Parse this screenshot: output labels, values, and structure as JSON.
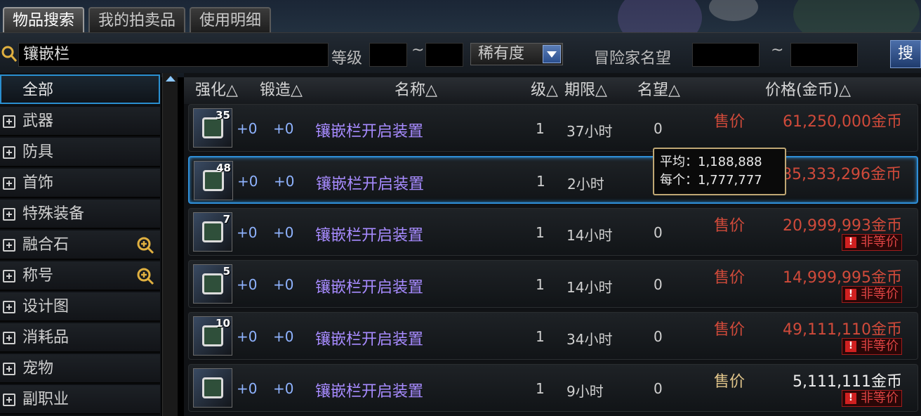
{
  "tabs": [
    {
      "label": "物品搜索",
      "active": true
    },
    {
      "label": "我的拍卖品",
      "active": false
    },
    {
      "label": "使用明细",
      "active": false
    }
  ],
  "search": {
    "value": "镶嵌栏",
    "level_label": "等级",
    "tilde": "~",
    "rarity_label": "稀有度",
    "fame_label": "冒险家名望",
    "button_label": "搜"
  },
  "sidebar": {
    "items": [
      {
        "label": "全部",
        "selected": true
      },
      {
        "label": "武器"
      },
      {
        "label": "防具"
      },
      {
        "label": "首饰"
      },
      {
        "label": "特殊装备"
      },
      {
        "label": "融合石",
        "zoom": true
      },
      {
        "label": "称号",
        "zoom": true
      },
      {
        "label": "设计图"
      },
      {
        "label": "消耗品"
      },
      {
        "label": "宠物"
      },
      {
        "label": "副职业"
      }
    ]
  },
  "table": {
    "headers": {
      "reinforce": "强化△",
      "forge": "锻造△",
      "name": "名称△",
      "level": "级△",
      "period": "期限△",
      "fame": "名望△",
      "price": "价格(金币)△"
    },
    "rows": [
      {
        "stack": "35",
        "reinforce": "+0",
        "forge": "+0",
        "name": "镶嵌栏开启装置",
        "level": "1",
        "period": "37小时",
        "fame": "0",
        "sell_label": "售价",
        "price": "61,250,000金币",
        "unfair": ""
      },
      {
        "stack": "48",
        "reinforce": "+0",
        "forge": "+0",
        "name": "镶嵌栏开启装置",
        "level": "1",
        "period": "2小时",
        "fame": "",
        "sell_label": "",
        "price": "85,333,296金币",
        "unfair": "",
        "selected": true
      },
      {
        "stack": "7",
        "reinforce": "+0",
        "forge": "+0",
        "name": "镶嵌栏开启装置",
        "level": "1",
        "period": "14小时",
        "fame": "0",
        "sell_label": "售价",
        "price": "20,999,993金币",
        "unfair": "非等价"
      },
      {
        "stack": "5",
        "reinforce": "+0",
        "forge": "+0",
        "name": "镶嵌栏开启装置",
        "level": "1",
        "period": "14小时",
        "fame": "0",
        "sell_label": "售价",
        "price": "14,999,995金币",
        "unfair": "非等价"
      },
      {
        "stack": "10",
        "reinforce": "+0",
        "forge": "+0",
        "name": "镶嵌栏开启装置",
        "level": "1",
        "period": "34小时",
        "fame": "0",
        "sell_label": "售价",
        "price": "49,111,110金币",
        "unfair": "非等价"
      },
      {
        "stack": "",
        "reinforce": "+0",
        "forge": "+0",
        "name": "镶嵌栏开启装置",
        "level": "1",
        "period": "9小时",
        "fame": "0",
        "sell_label": "售价",
        "price": "5,111,111金币",
        "unfair": "非等价"
      }
    ]
  },
  "tooltip": {
    "avg_line": "平均：1,188,888",
    "each_line": "每个：1,777,777"
  },
  "colors": {
    "accent_blue": "#2f8fd8",
    "price_red": "#d04a3a",
    "item_name_purple": "#a78bff",
    "tooltip_border": "#bfa774"
  }
}
